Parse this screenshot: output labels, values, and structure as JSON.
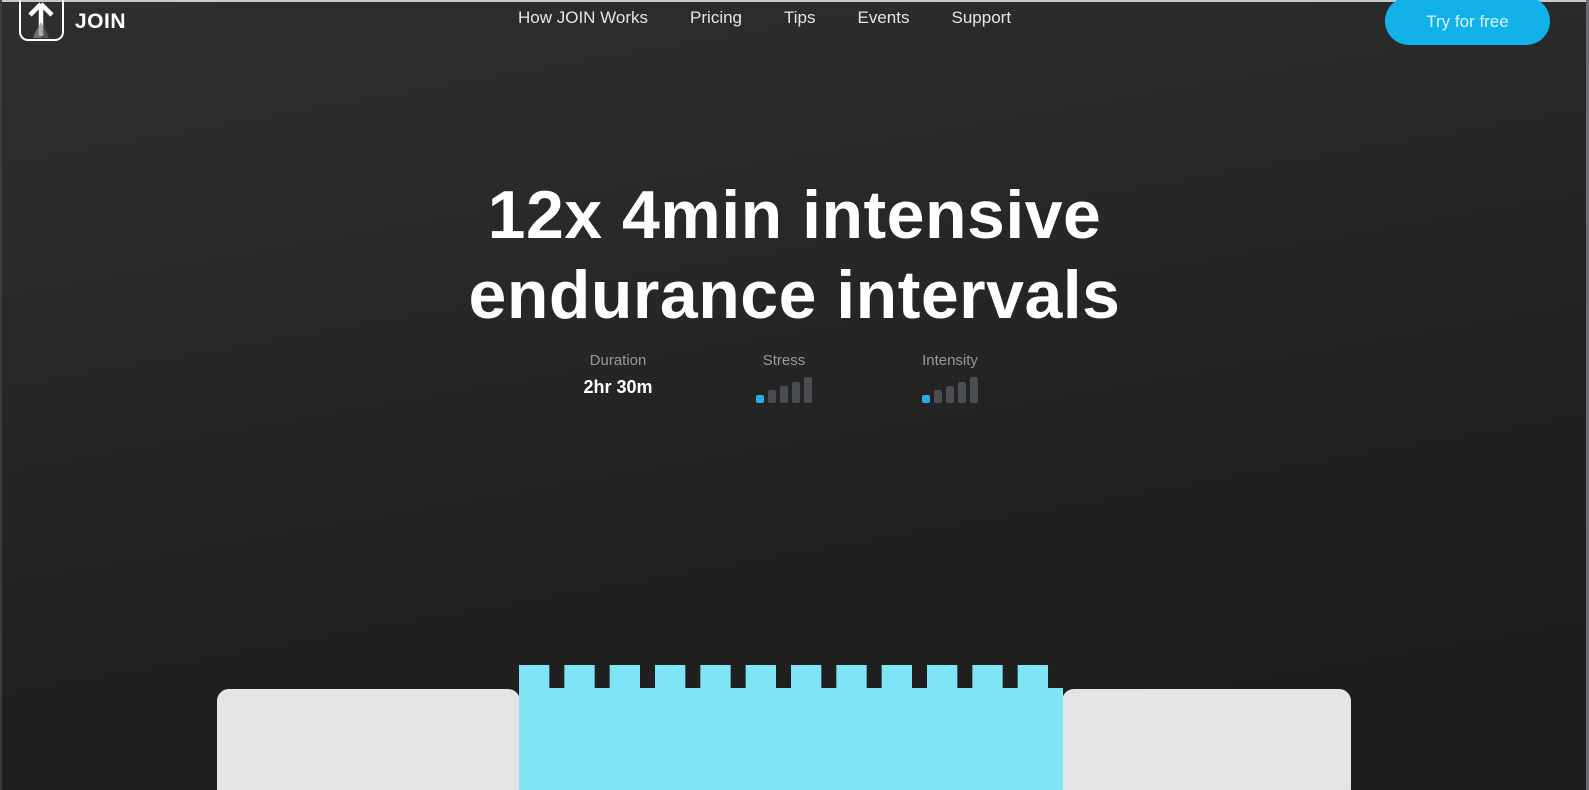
{
  "header": {
    "logo_text": "JOIN",
    "nav": [
      {
        "label": "How JOIN Works"
      },
      {
        "label": "Pricing"
      },
      {
        "label": "Tips"
      },
      {
        "label": "Events"
      },
      {
        "label": "Support"
      }
    ],
    "cta_label": "Try for free"
  },
  "hero": {
    "title_line1": "12x 4min intensive",
    "title_line2": "endurance intervals"
  },
  "stats": {
    "duration": {
      "label": "Duration",
      "value": "2hr 30m"
    },
    "stress": {
      "label": "Stress",
      "level": 1,
      "max": 5
    },
    "intensity": {
      "label": "Intensity",
      "level": 1,
      "max": 5
    }
  },
  "workout_graph": {
    "interval_count": 12,
    "colors": {
      "interval": "#7fe5f6",
      "panel": "#e4e4e6"
    }
  },
  "colors": {
    "accent": "#13b1ea",
    "level_on": "#27aee6",
    "level_off": "#4a4e53"
  }
}
